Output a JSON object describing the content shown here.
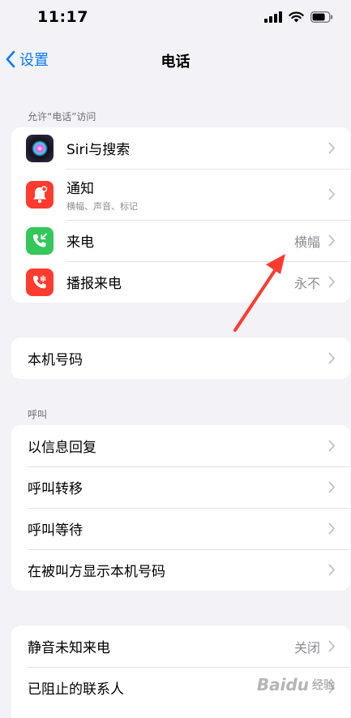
{
  "status_bar": {
    "time": "11:17"
  },
  "nav": {
    "back_label": "设置",
    "title": "电话"
  },
  "sections": {
    "allow_access": {
      "header": "允许“电话”访问",
      "rows": [
        {
          "title": "Siri与搜索",
          "subtitle": "",
          "value": "",
          "icon": "siri-icon",
          "color": "#2b2b3a"
        },
        {
          "title": "通知",
          "subtitle": "横幅、声音、标记",
          "value": "",
          "icon": "notification-bell-icon",
          "color": "#ff3b30"
        },
        {
          "title": "来电",
          "subtitle": "",
          "value": "横幅",
          "icon": "incoming-call-icon",
          "color": "#34c759"
        },
        {
          "title": "播报来电",
          "subtitle": "",
          "value": "永不",
          "icon": "announce-call-icon",
          "color": "#ff3b30"
        }
      ]
    },
    "my_number": {
      "rows": [
        {
          "title": "本机号码",
          "value": ""
        }
      ]
    },
    "calls": {
      "header": "呼叫",
      "rows": [
        {
          "title": "以信息回复",
          "value": ""
        },
        {
          "title": "呼叫转移",
          "value": ""
        },
        {
          "title": "呼叫等待",
          "value": ""
        },
        {
          "title": "在被叫方显示本机号码",
          "value": ""
        }
      ]
    },
    "blocking": {
      "rows": [
        {
          "title": "静音未知来电",
          "value": "关闭"
        },
        {
          "title": "已阻止的联系人",
          "value": ""
        }
      ]
    }
  },
  "annotation": {
    "arrow_color": "#ff3b30"
  },
  "watermark": {
    "brand": "Baidu",
    "sub": "经验"
  }
}
